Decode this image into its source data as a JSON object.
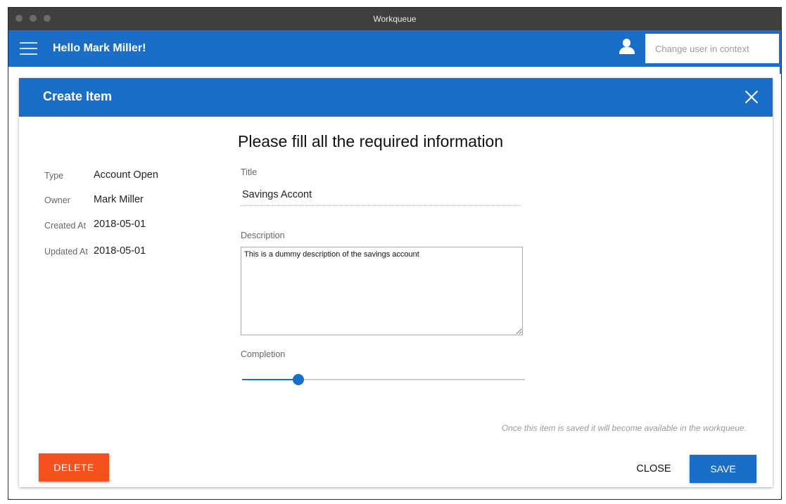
{
  "window": {
    "title": "Workqueue"
  },
  "appbar": {
    "greeting": "Hello Mark Miller!",
    "user_search_placeholder": "Change user in context",
    "user_search_value": ""
  },
  "dialog": {
    "title": "Create Item",
    "heading": "Please fill all the required information",
    "meta": [
      {
        "label": "Type",
        "value": "Account Open"
      },
      {
        "label": "Owner",
        "value": "Mark Miller"
      },
      {
        "label": "Created At",
        "value": "2018-05-01"
      },
      {
        "label": "Updated At",
        "value": "2018-05-01"
      }
    ],
    "fields": {
      "title_label": "Title",
      "title_value": "Savings Accont",
      "description_label": "Description",
      "description_value": "This is a dummy description of the savings account",
      "completion_label": "Completion",
      "completion_percent": 20
    },
    "hint": "Once this item is saved it will become available in the workqueue.",
    "buttons": {
      "delete": "DELETE",
      "close": "CLOSE",
      "save": "SAVE"
    }
  },
  "colors": {
    "primary": "#1a6ec8",
    "danger": "#f4511e",
    "titlebar": "#3f3f3f"
  }
}
